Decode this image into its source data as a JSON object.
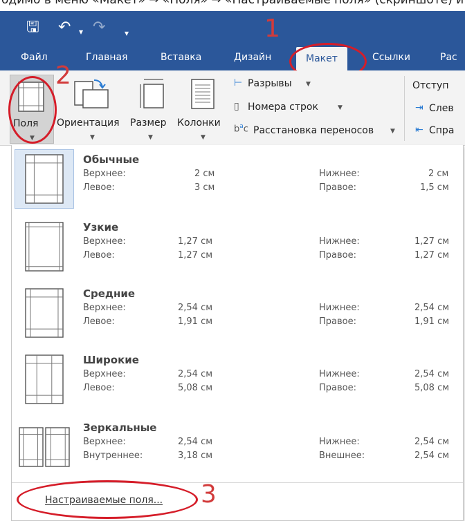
{
  "app": {
    "top_text": "одимо в меню «Макет» → «Поля» → «Настраиваемые поля» (скриншоте) и",
    "quick_access": {
      "save_icon": "🖫",
      "undo_icon": "↶",
      "redo_icon": "↷",
      "more_icon": "▾"
    }
  },
  "annotations": {
    "n1": "1",
    "n2": "2",
    "n3": "3"
  },
  "tabs": [
    {
      "label": "Файл"
    },
    {
      "label": "Главная"
    },
    {
      "label": "Вставка"
    },
    {
      "label": "Дизайн"
    },
    {
      "label": "Макет"
    },
    {
      "label": "Ссылки"
    },
    {
      "label": "Рас"
    }
  ],
  "ribbon": {
    "fields": "Поля",
    "orientation": "Ориентация",
    "size": "Размер",
    "columns": "Колонки",
    "breaks": "Разрывы",
    "line_numbers": "Номера строк",
    "hyphenation": "Расстановка переносов",
    "indent": "Отступ",
    "left": "Слев",
    "right": "Спра"
  },
  "presets": [
    {
      "name": "Обычные",
      "l1": "Верхнее:",
      "v1": "2 см",
      "l2": "Левое:",
      "v2": "3 см",
      "l3": "Нижнее:",
      "v3": "2 см",
      "l4": "Правое:",
      "v4": "1,5 см",
      "margins": [
        0.17,
        0.23,
        0.17,
        0.15
      ]
    },
    {
      "name": "Узкие",
      "l1": "Верхнее:",
      "v1": "1,27 см",
      "l2": "Левое:",
      "v2": "1,27 см",
      "l3": "Нижнее:",
      "v3": "1,27 см",
      "l4": "Правое:",
      "v4": "1,27 см",
      "margins": [
        0.09,
        0.09,
        0.09,
        0.09
      ]
    },
    {
      "name": "Средние",
      "l1": "Верхнее:",
      "v1": "2,54 см",
      "l2": "Левое:",
      "v2": "1,91 см",
      "l3": "Нижнее:",
      "v3": "2,54 см",
      "l4": "Правое:",
      "v4": "1,91 см",
      "margins": [
        0.17,
        0.13,
        0.17,
        0.13
      ]
    },
    {
      "name": "Широкие",
      "l1": "Верхнее:",
      "v1": "2,54 см",
      "l2": "Левое:",
      "v2": "5,08 см",
      "l3": "Нижнее:",
      "v3": "2,54 см",
      "l4": "Правое:",
      "v4": "5,08 см",
      "margins": [
        0.17,
        0.3,
        0.17,
        0.3
      ]
    },
    {
      "name": "Зеркальные",
      "l1": "Верхнее:",
      "v1": "2,54 см",
      "l2": "Внутреннее:",
      "v2": "3,18 см",
      "l3": "Нижнее:",
      "v3": "2,54 см",
      "l4": "Внешнее:",
      "v4": "2,54 см",
      "margins": [
        0.17,
        0.22,
        0.17,
        0.17
      ]
    }
  ],
  "footer": {
    "first_letter": "Н",
    "rest": "астраиваемые поля..."
  },
  "colors": {
    "word_blue": "#2b579a",
    "annotation_red": "#d51d29",
    "ribbon_bg": "#f3f3f3"
  }
}
